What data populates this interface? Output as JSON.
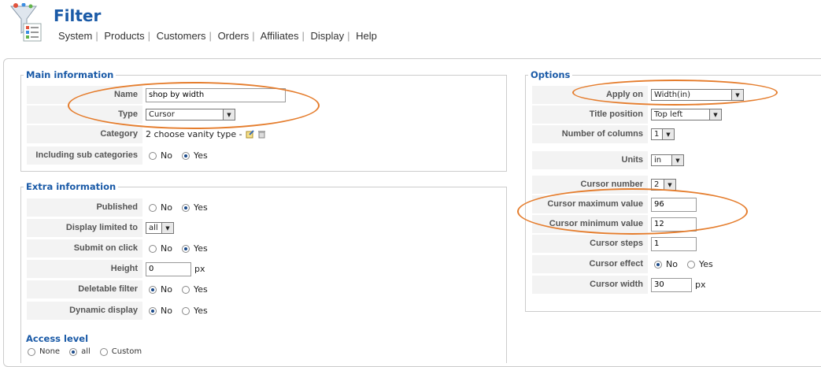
{
  "header": {
    "title": "Filter",
    "menu": [
      "System",
      "Products",
      "Customers",
      "Orders",
      "Affiliates",
      "Display",
      "Help"
    ]
  },
  "main_info": {
    "legend": "Main information",
    "name_label": "Name",
    "name_value": "shop by width",
    "type_label": "Type",
    "type_value": "Cursor",
    "category_label": "Category",
    "category_value": "2 choose vanity type -",
    "incl_label": "Including sub categories",
    "incl_no": "No",
    "incl_yes": "Yes"
  },
  "extra_info": {
    "legend": "Extra information",
    "published_label": "Published",
    "published_no": "No",
    "published_yes": "Yes",
    "display_limited_label": "Display limited to",
    "display_limited_value": "all",
    "submit_label": "Submit on click",
    "submit_no": "No",
    "submit_yes": "Yes",
    "height_label": "Height",
    "height_value": "0",
    "height_unit": "px",
    "deletable_label": "Deletable filter",
    "deletable_no": "No",
    "deletable_yes": "Yes",
    "dynamic_label": "Dynamic display",
    "dynamic_no": "No",
    "dynamic_yes": "Yes"
  },
  "access": {
    "title": "Access level",
    "none": "None",
    "all": "all",
    "custom": "Custom"
  },
  "options": {
    "legend": "Options",
    "apply_on_label": "Apply on",
    "apply_on_value": "Width(in)",
    "title_pos_label": "Title position",
    "title_pos_value": "Top left",
    "num_cols_label": "Number of columns",
    "num_cols_value": "1",
    "units_label": "Units",
    "units_value": "in",
    "cursor_number_label": "Cursor number",
    "cursor_number_value": "2",
    "cursor_max_label": "Cursor maximum value",
    "cursor_max_value": "96",
    "cursor_min_label": "Cursor minimum value",
    "cursor_min_value": "12",
    "cursor_steps_label": "Cursor steps",
    "cursor_steps_value": "1",
    "cursor_effect_label": "Cursor effect",
    "cursor_effect_no": "No",
    "cursor_effect_yes": "Yes",
    "cursor_width_label": "Cursor width",
    "cursor_width_value": "30",
    "cursor_width_unit": "px"
  },
  "colors": {
    "accent": "#1a5aa7",
    "highlight": "#e57d2d",
    "label_bg": "#f3f3f3"
  }
}
